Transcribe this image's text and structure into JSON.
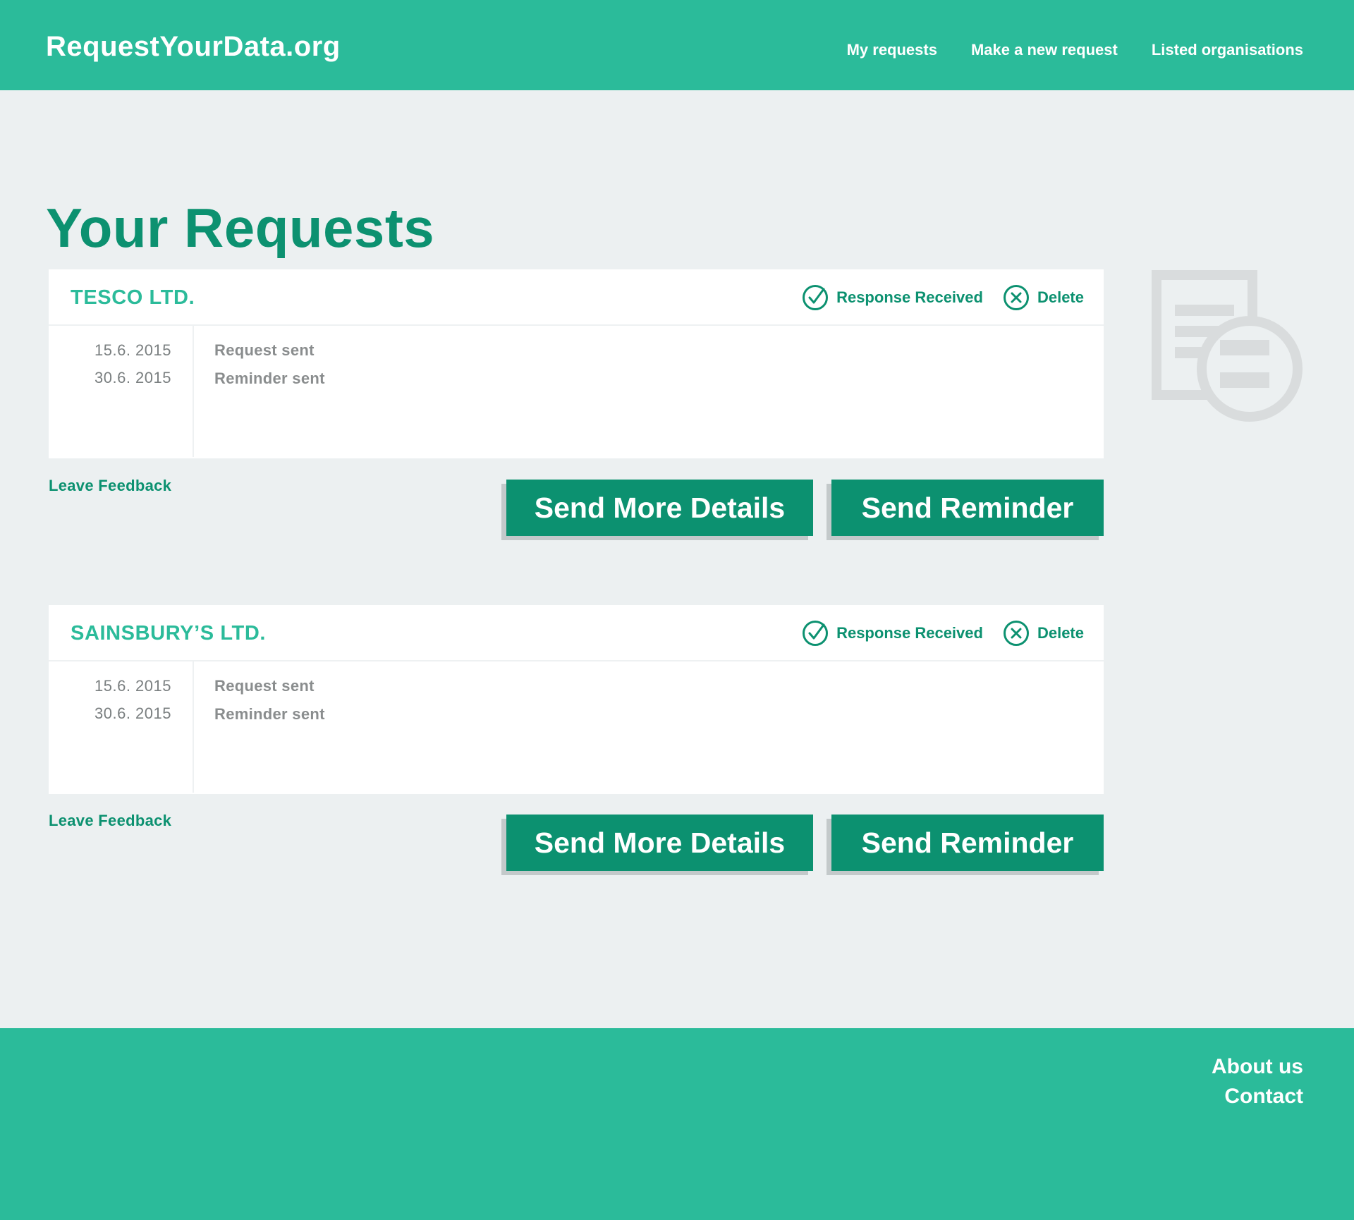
{
  "header": {
    "logo": "RequestYourData.org",
    "nav": [
      "My requests",
      "Make a new request",
      "Listed organisations"
    ]
  },
  "main": {
    "title": "Your Requests",
    "requests": [
      {
        "company": "TESCO LTD.",
        "status_label": "Response Received",
        "delete_label": "Delete",
        "events": [
          {
            "date": "15.6. 2015",
            "label": "Request sent"
          },
          {
            "date": "30.6. 2015",
            "label": "Reminder sent"
          }
        ],
        "feedback_label": "Leave Feedback",
        "details_button": "Send More Details",
        "reminder_button": "Send Reminder"
      },
      {
        "company": "SAINSBURY’S LTD.",
        "status_label": "Response Received",
        "delete_label": "Delete",
        "events": [
          {
            "date": "15.6. 2015",
            "label": "Request sent"
          },
          {
            "date": "30.6. 2015",
            "label": "Reminder sent"
          }
        ],
        "feedback_label": "Leave Feedback",
        "details_button": "Send More Details",
        "reminder_button": "Send Reminder"
      }
    ]
  },
  "sidebar": {
    "icon": "document-search-icon"
  },
  "footer": {
    "links": [
      "About us",
      "Contact"
    ]
  },
  "colors": {
    "brand": "#2bbb9a",
    "accent": "#0c9170",
    "background": "#ecf0f1",
    "card": "#ffffff",
    "muted_text": "#8a8d8e",
    "icon_gray": "#d9dcdd"
  }
}
